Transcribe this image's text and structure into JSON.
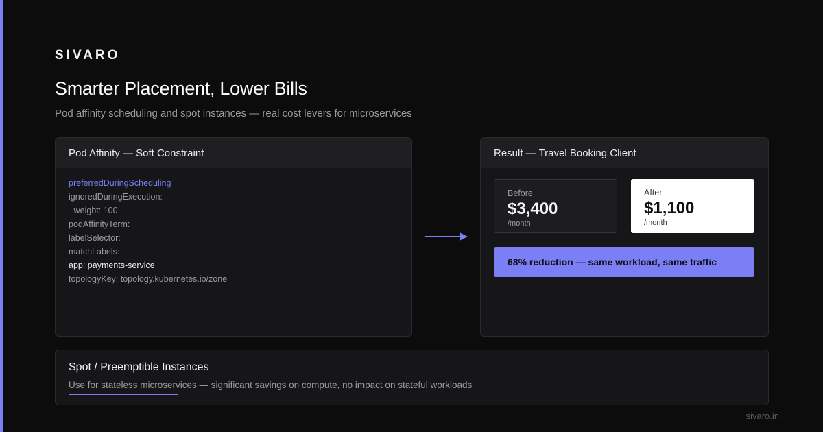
{
  "brand": "SIVARO",
  "title": "Smarter Placement, Lower Bills",
  "subtitle": "Pod affinity scheduling and spot instances — real cost levers for microservices",
  "colors": {
    "accent": "#7b7ff5",
    "background": "#0c0c0d",
    "card": "#161618"
  },
  "affinity_card": {
    "heading": "Pod Affinity — Soft Constraint",
    "code_lines": [
      "preferredDuringScheduling",
      "ignoredDuringExecution:",
      "- weight: 100",
      "podAffinityTerm:",
      "labelSelector:",
      "matchLabels:",
      "app: payments-service",
      "topologyKey: topology.kubernetes.io/zone"
    ]
  },
  "arrow_icon": "arrow-right-icon",
  "result_card": {
    "heading": "Result — Travel Booking Client",
    "before": {
      "label": "Before",
      "value": "$3,400",
      "unit": "/month"
    },
    "after": {
      "label": "After",
      "value": "$1,100",
      "unit": "/month"
    },
    "reduction": "68% reduction — same workload, same traffic"
  },
  "spot_card": {
    "title": "Spot / Preemptible Instances",
    "description": "Use for stateless microservices — significant savings on compute, no impact on stateful workloads"
  },
  "footer": "sivaro.in"
}
